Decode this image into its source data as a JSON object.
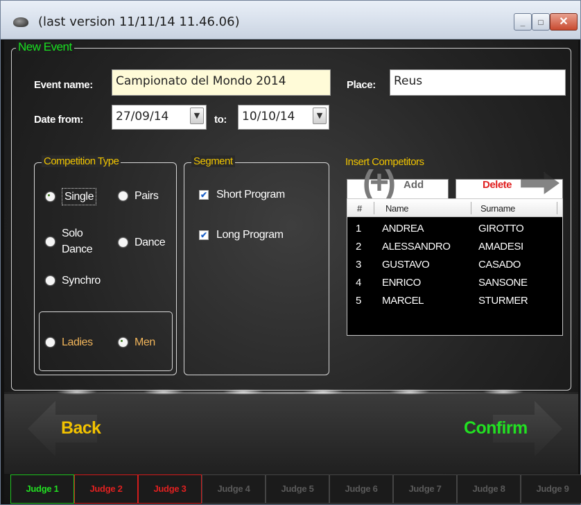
{
  "window": {
    "title": "(last version 11/11/14 11.46.06)",
    "icon": "turtle-icon",
    "controls": {
      "minimize": "_",
      "maximize": "□",
      "close": "✕"
    }
  },
  "new_event": {
    "legend": "New Event",
    "event_name_label": "Event name:",
    "event_name_value": "Campionato del Mondo 2014",
    "place_label": "Place:",
    "place_value": "Reus",
    "date_from_label": "Date from:",
    "date_from_value": "27/09/14",
    "to_label": "to:",
    "date_to_value": "10/10/14",
    "combo_arrow": "▼"
  },
  "competition_type": {
    "legend": "Competition Type",
    "options": [
      {
        "label": "Single",
        "checked": true
      },
      {
        "label": "Pairs",
        "checked": false
      },
      {
        "label": "Solo Dance",
        "line1": "Solo",
        "line2": "Dance",
        "checked": false
      },
      {
        "label": "Dance",
        "checked": false
      },
      {
        "label": "Synchro",
        "checked": false
      }
    ],
    "gender": [
      {
        "label": "Ladies",
        "checked": false
      },
      {
        "label": "Men",
        "checked": true
      }
    ]
  },
  "segment": {
    "legend": "Segment",
    "options": [
      {
        "label": "Short Program",
        "checked": true
      },
      {
        "label": "Long Program",
        "checked": true
      }
    ],
    "check_glyph": "✔"
  },
  "competitors": {
    "legend": "Insert Competitors",
    "first_name_input": "",
    "last_name_input": "",
    "add_icon": "(+)",
    "add_label": "Add",
    "delete_label": "Delete",
    "columns": [
      "#",
      "Name",
      "Surname"
    ],
    "rows": [
      {
        "num": "1",
        "name": "ANDREA",
        "surname": "GIROTTO"
      },
      {
        "num": "2",
        "name": "ALESSANDRO",
        "surname": "AMADESI"
      },
      {
        "num": "3",
        "name": "GUSTAVO",
        "surname": "CASADO"
      },
      {
        "num": "4",
        "name": "ENRICO",
        "surname": "SANSONE"
      },
      {
        "num": "5",
        "name": "MARCEL",
        "surname": "STURMER"
      }
    ]
  },
  "navigation": {
    "back_label": "Back",
    "confirm_label": "Confirm",
    "back_color": "#f2c200",
    "confirm_color": "#22e022"
  },
  "judges": [
    {
      "label": "Judge 1",
      "state": "active"
    },
    {
      "label": "Judge 2",
      "state": "set"
    },
    {
      "label": "Judge 3",
      "state": "set"
    },
    {
      "label": "Judge 4",
      "state": "inactive"
    },
    {
      "label": "Judge 5",
      "state": "inactive"
    },
    {
      "label": "Judge 6",
      "state": "inactive"
    },
    {
      "label": "Judge 7",
      "state": "inactive"
    },
    {
      "label": "Judge 8",
      "state": "inactive"
    },
    {
      "label": "Judge 9",
      "state": "inactive"
    }
  ]
}
